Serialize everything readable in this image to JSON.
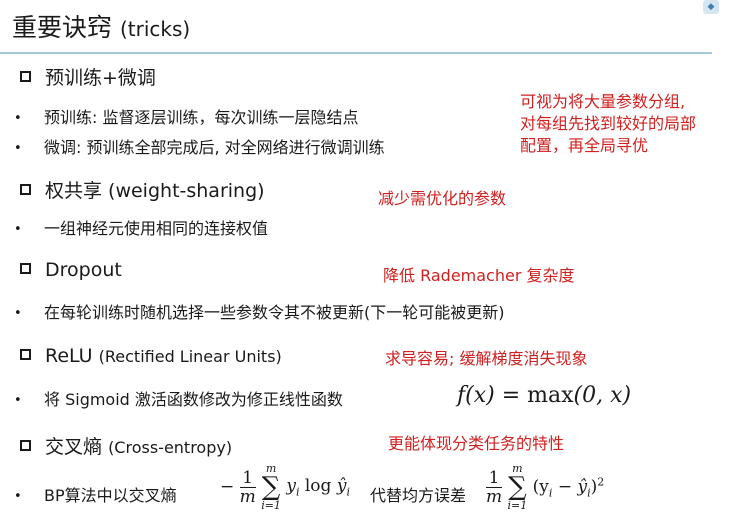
{
  "title": {
    "main": "重要诀窍",
    "sub": "(tricks)"
  },
  "sections": [
    {
      "heading": "预训练+微调",
      "heading_extra": "",
      "bullets": [
        "预训练: 监督逐层训练，每次训练一层隐结点",
        "微调: 预训练全部完成后, 对全网络进行微调训练"
      ],
      "note": [
        "可视为将大量参数分组,",
        "对每组先找到较好的局部",
        "配置，再全局寻优"
      ]
    },
    {
      "heading": "权共享 (weight-sharing)",
      "heading_extra": "",
      "bullets": [
        "一组神经元使用相同的连接权值"
      ],
      "note": [
        "减少需优化的参数"
      ]
    },
    {
      "heading": "Dropout",
      "heading_extra": "",
      "bullets": [
        "在每轮训练时随机选择一些参数令其不被更新(下一轮可能被更新)"
      ],
      "note": [
        "降低 Rademacher 复杂度"
      ]
    },
    {
      "heading": "ReLU",
      "heading_extra": "(Rectified Linear Units)",
      "bullets": [
        "将 Sigmoid 激活函数修改为修正线性函数"
      ],
      "note": [
        "求导容易; 缓解梯度消失现象"
      ]
    },
    {
      "heading": "交叉熵",
      "heading_extra": "(Cross-entropy)",
      "bullets": [
        "BP算法中以交叉熵",
        "代替均方误差"
      ],
      "note": [
        "更能体现分类任务的特性"
      ]
    }
  ],
  "formulas": {
    "relu": {
      "lhs": "f(x)",
      "eq": "=",
      "fn": "max",
      "args": "(0, x)"
    },
    "cross_entropy": {
      "sign": "−",
      "num": "1",
      "den": "m",
      "sum_top": "m",
      "sum_bottom": "i=1",
      "term": "y",
      "sub_i": "i",
      "log": "log",
      "yhat": "ŷ"
    },
    "mse": {
      "num": "1",
      "den": "m",
      "sum_top": "m",
      "sum_bottom": "i=1",
      "term": "(y",
      "sub_i": "i",
      "minus": "−",
      "yhat": "ŷ",
      "close": ")",
      "pow": "2"
    }
  },
  "colors": {
    "note": "#d02020",
    "rule": "#a9c8d6",
    "text": "#1a1a1a"
  },
  "icons": {
    "bullet_square": "open-square",
    "bullet": "dot",
    "corner": "app-badge"
  }
}
